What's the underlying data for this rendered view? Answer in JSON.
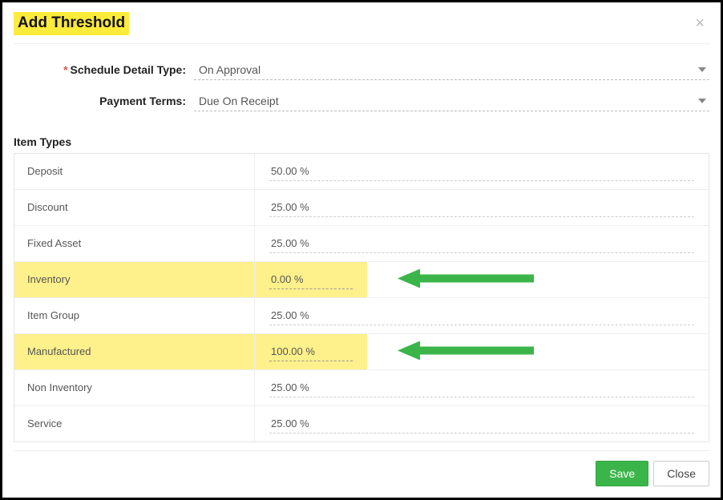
{
  "header": {
    "title": "Add Threshold"
  },
  "fields": {
    "schedule_detail_type": {
      "label": "Schedule Detail Type:",
      "required_marker": "*",
      "value": "On Approval"
    },
    "payment_terms": {
      "label": "Payment Terms:",
      "value": "Due On Receipt"
    }
  },
  "item_types": {
    "heading": "Item Types",
    "rows": [
      {
        "name": "Deposit",
        "value": "50.00 %",
        "highlight": false,
        "arrow": false
      },
      {
        "name": "Discount",
        "value": "25.00 %",
        "highlight": false,
        "arrow": false
      },
      {
        "name": "Fixed Asset",
        "value": "25.00 %",
        "highlight": false,
        "arrow": false
      },
      {
        "name": "Inventory",
        "value": "0.00 %",
        "highlight": true,
        "arrow": true
      },
      {
        "name": "Item Group",
        "value": "25.00 %",
        "highlight": false,
        "arrow": false
      },
      {
        "name": "Manufactured",
        "value": "100.00 %",
        "highlight": true,
        "arrow": true
      },
      {
        "name": "Non Inventory",
        "value": "25.00 %",
        "highlight": false,
        "arrow": false
      },
      {
        "name": "Service",
        "value": "25.00 %",
        "highlight": false,
        "arrow": false
      }
    ]
  },
  "buttons": {
    "save": "Save",
    "close": "Close"
  },
  "colors": {
    "highlight": "#fef08a",
    "arrow": "#3bb54a",
    "save_button": "#3bb54a"
  }
}
